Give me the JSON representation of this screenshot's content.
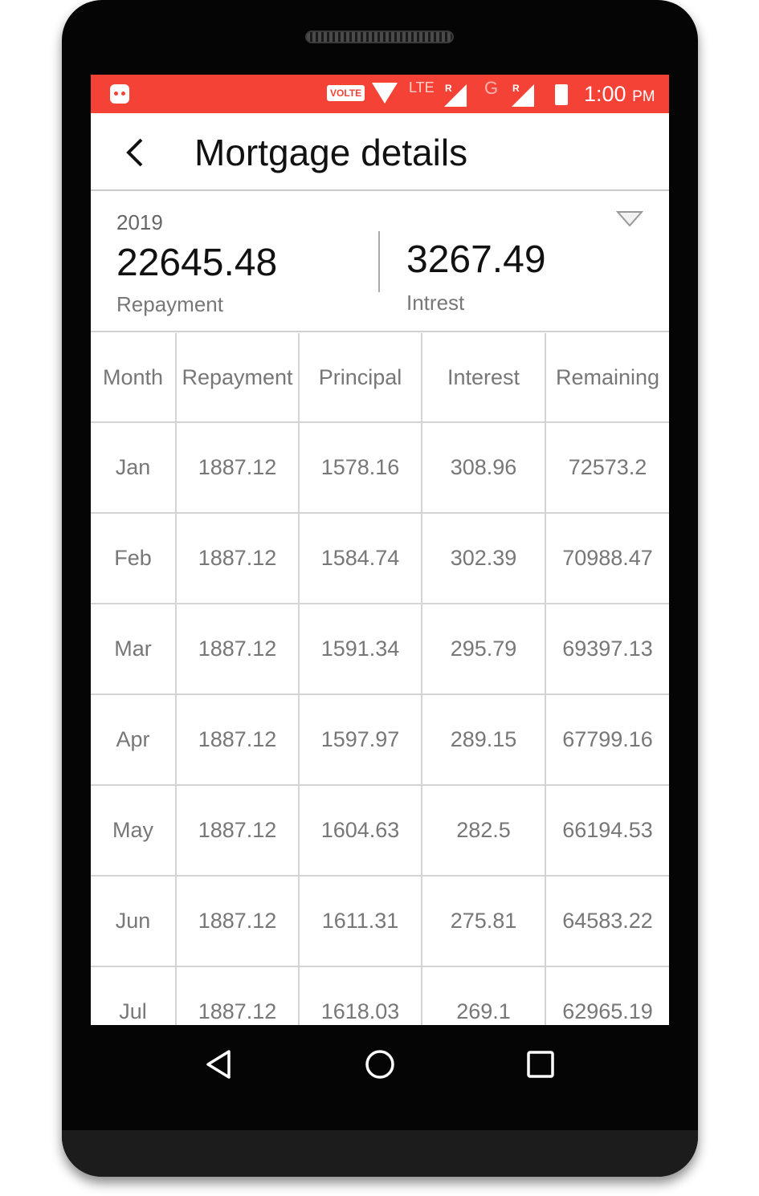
{
  "statusbar": {
    "volte": "VOLTE",
    "network1": "LTE",
    "roaming1": "R",
    "network2": "G",
    "roaming2": "R",
    "time": "1:00",
    "ampm": "PM"
  },
  "toolbar": {
    "title": "Mortgage details"
  },
  "summary": {
    "year": "2019",
    "repayment_value": "22645.48",
    "repayment_label": "Repayment",
    "interest_value": "3267.49",
    "interest_label": "Intrest"
  },
  "table": {
    "headers": [
      "Month",
      "Repayment",
      "Principal",
      "Interest",
      "Remaining"
    ],
    "rows": [
      [
        "Jan",
        "1887.12",
        "1578.16",
        "308.96",
        "72573.2"
      ],
      [
        "Feb",
        "1887.12",
        "1584.74",
        "302.39",
        "70988.47"
      ],
      [
        "Mar",
        "1887.12",
        "1591.34",
        "295.79",
        "69397.13"
      ],
      [
        "Apr",
        "1887.12",
        "1597.97",
        "289.15",
        "67799.16"
      ],
      [
        "May",
        "1887.12",
        "1604.63",
        "282.5",
        "66194.53"
      ],
      [
        "Jun",
        "1887.12",
        "1611.31",
        "275.81",
        "64583.22"
      ],
      [
        "Jul",
        "1887.12",
        "1618.03",
        "269.1",
        "62965.19"
      ]
    ]
  },
  "colors": {
    "statusbar": "#f44336",
    "text_primary": "#111111",
    "text_secondary": "#777777"
  }
}
